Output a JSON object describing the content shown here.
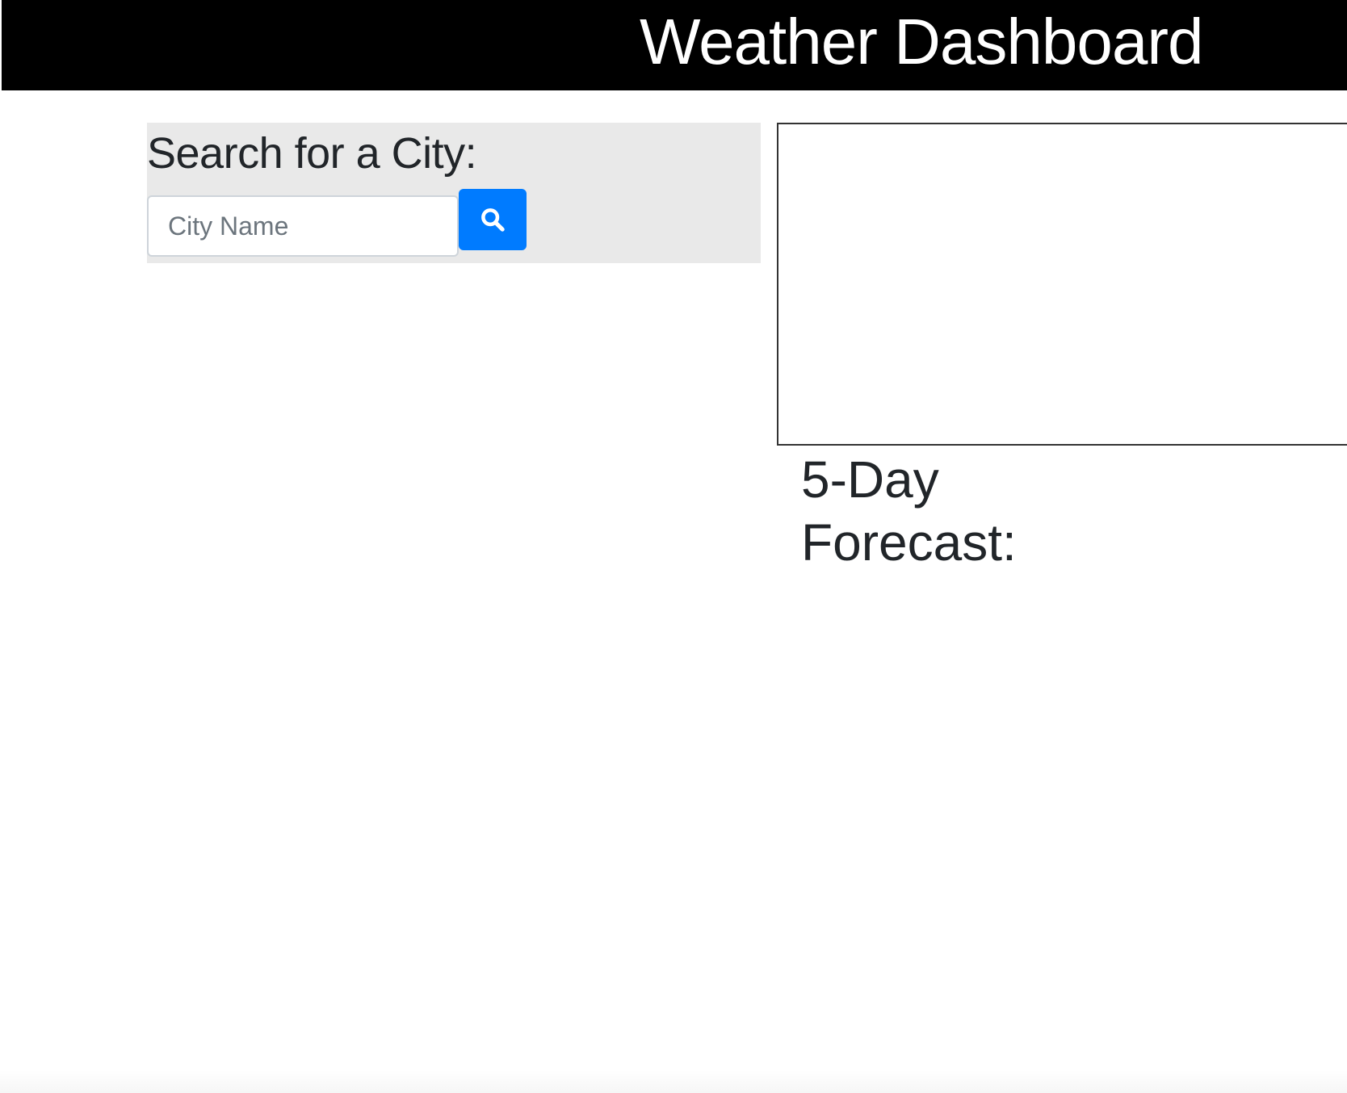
{
  "header": {
    "title": "Weather Dashboard"
  },
  "search": {
    "heading": "Search for a City:",
    "placeholder": "City Name",
    "value": "",
    "button_icon": "search-icon"
  },
  "current_weather": {
    "content": ""
  },
  "forecast": {
    "heading": "5-Day Forecast:"
  },
  "colors": {
    "header_background": "#000000",
    "header_text": "#ffffff",
    "search_panel_background": "#e9e9e9",
    "search_button": "#007bff",
    "text": "#212529",
    "box_border": "#333333"
  }
}
